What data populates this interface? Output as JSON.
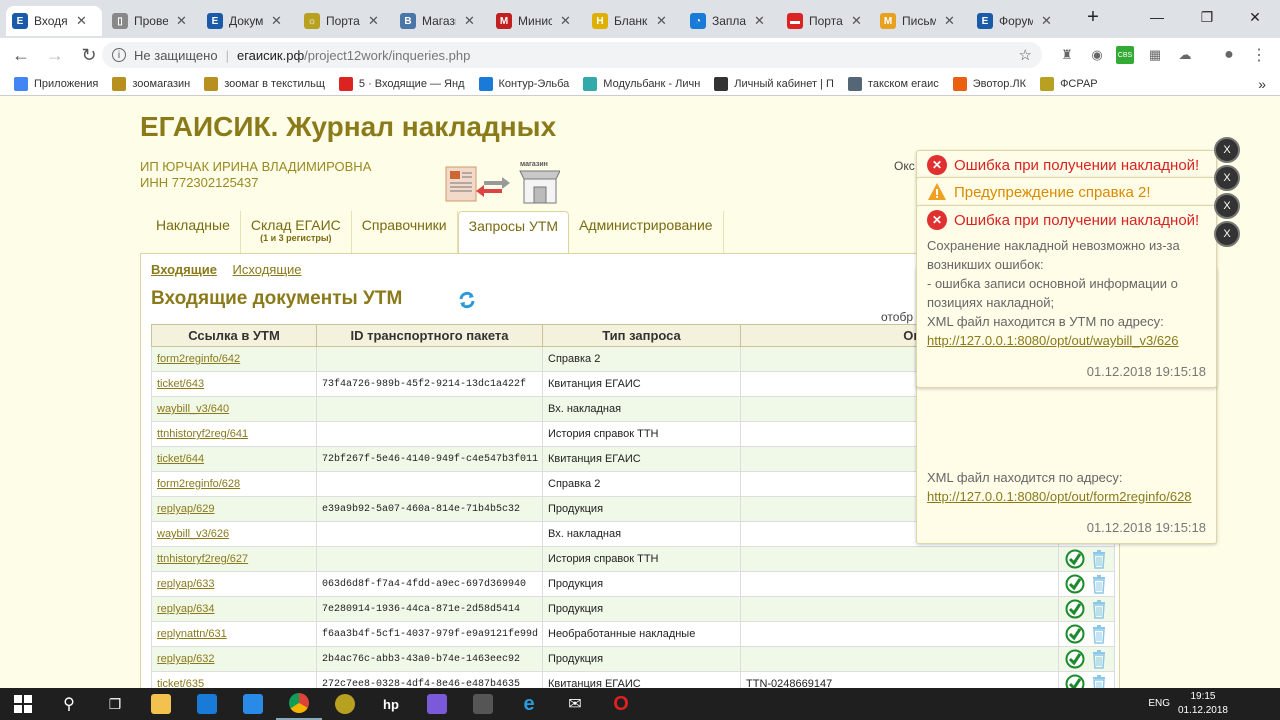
{
  "browser": {
    "tabs": [
      {
        "label": "Входящ",
        "icon": "E",
        "color": "#1a5aa8",
        "active": true
      },
      {
        "label": "Прове",
        "icon": "▯",
        "color": "#888"
      },
      {
        "label": "Докум",
        "icon": "E",
        "color": "#1a5aa8"
      },
      {
        "label": "Порта",
        "icon": "☼",
        "color": "#b8a020"
      },
      {
        "label": "Магази",
        "icon": "B",
        "color": "#4a76a8"
      },
      {
        "label": "Минис",
        "icon": "M",
        "color": "#c02020"
      },
      {
        "label": "Бланк",
        "icon": "H",
        "color": "#e0b000"
      },
      {
        "label": "Запла",
        "icon": "◔",
        "color": "#1a7ad8"
      },
      {
        "label": "Порта",
        "icon": "▬",
        "color": "#d22"
      },
      {
        "label": "Письм",
        "icon": "M",
        "color": "#e8a020"
      },
      {
        "label": "Форум",
        "icon": "E",
        "color": "#1a5aa8"
      }
    ],
    "new_tab": "+",
    "url_insecure": "Не защищено",
    "url_host": "егаисик.рф",
    "url_path": "/project12work/inqueries.php",
    "bookmarks": [
      {
        "label": "Приложения",
        "color": "#4285f4"
      },
      {
        "label": "зоомагазин",
        "color": "#b89020"
      },
      {
        "label": "зоомаг в текстильщ",
        "color": "#b89020"
      },
      {
        "label": "5 · Входящие — Янд",
        "color": "#d22"
      },
      {
        "label": "Контур-Эльба",
        "color": "#1a7ad8"
      },
      {
        "label": "Модульбанк - Личн",
        "color": "#3aa"
      },
      {
        "label": "Личный кабинет | П",
        "color": "#333"
      },
      {
        "label": "такском егаис",
        "color": "#567"
      },
      {
        "label": "Эвотор.ЛК",
        "color": "#e86010"
      },
      {
        "label": "ФСРАР",
        "color": "#b8a020"
      }
    ],
    "bookmarks_more": "»"
  },
  "app": {
    "title": "ЕГАИСИК. Журнал накладных",
    "org_name": "ИП ЮРЧАК ИРИНА ВЛАДИМИРОВНА",
    "inn": "ИНН 772302125437",
    "logo_text_top": "магазин",
    "okso": "Окс",
    "nav": [
      {
        "label": "Накладные"
      },
      {
        "label": "Склад ЕГАИС",
        "sub": "(1 и 3 регистры)"
      },
      {
        "label": "Справочники"
      },
      {
        "label": "Запросы УТМ",
        "active": true
      },
      {
        "label": "Администрирование"
      }
    ],
    "subtabs": {
      "incoming": "Входящие",
      "outgoing": "Исходящие"
    },
    "doc_title": "Входящие документы УТМ",
    "shown_label": "отобр",
    "table": {
      "headers": [
        "Ссылка в УТМ",
        "ID транспортного пакета",
        "Тип запроса",
        "Описан"
      ],
      "rows": [
        {
          "link": "form2reginfo/642",
          "id": "",
          "type": "Справка 2",
          "desc": "",
          "status": ""
        },
        {
          "link": "ticket/643",
          "id": "73f4a726-989b-45f2-9214-13dc1a422f",
          "type": "Квитанция ЕГАИС",
          "desc": "",
          "status": ""
        },
        {
          "link": "waybill_v3/640",
          "id": "",
          "type": "Вх. накладная",
          "desc": "",
          "status": ""
        },
        {
          "link": "ttnhistoryf2reg/641",
          "id": "",
          "type": "История справок ТТН",
          "desc": "",
          "status": ""
        },
        {
          "link": "ticket/644",
          "id": "72bf267f-5e46-4140-949f-c4e547b3f011",
          "type": "Квитанция ЕГАИС",
          "desc": "",
          "status": ""
        },
        {
          "link": "form2reginfo/628",
          "id": "",
          "type": "Справка 2",
          "desc": "",
          "status": "none"
        },
        {
          "link": "replyap/629",
          "id": "e39a9b92-5a07-460a-814e-71b4b5c32",
          "type": "Продукция",
          "desc": "",
          "status": "ok"
        },
        {
          "link": "waybill_v3/626",
          "id": "",
          "type": "Вх. накладная",
          "desc": "",
          "status": "warn"
        },
        {
          "link": "ttnhistoryf2reg/627",
          "id": "",
          "type": "История справок ТТН",
          "desc": "",
          "status": "ok"
        },
        {
          "link": "replyap/633",
          "id": "063d6d8f-f7a4-4fdd-a9ec-697d369940",
          "type": "Продукция",
          "desc": "",
          "status": "ok"
        },
        {
          "link": "replyap/634",
          "id": "7e280914-1936-44ca-871e-2d58d5414",
          "type": "Продукция",
          "desc": "",
          "status": "ok"
        },
        {
          "link": "replynattn/631",
          "id": "f6aa3b4f-5cf1-4037-979f-e9a9121fe99d",
          "type": "Необработанные накладные",
          "desc": "",
          "status": "ok"
        },
        {
          "link": "replyap/632",
          "id": "2b4ac76c-abb3-43a0-b74e-1463eec92",
          "type": "Продукция",
          "desc": "",
          "status": "ok"
        },
        {
          "link": "ticket/635",
          "id": "272c7ee8-0328-4df4-8e46-e487b4635",
          "type": "Квитанция ЕГАИС",
          "desc": "TTN-0248669147",
          "status": "ok"
        }
      ]
    }
  },
  "notifications": [
    {
      "kind": "error",
      "title": "Ошибка при получении накладной!"
    },
    {
      "kind": "warning",
      "title": "Предупреждение справка 2!"
    },
    {
      "kind": "error",
      "title": "Ошибка при получении накладной!",
      "lines": [
        "Сохранение накладной невозможно из-за возникших ошибок:",
        "- ошибка записи основной информации о позициях накладной;",
        "XML файл находится в УТМ по адресу:"
      ],
      "link": "http://127.0.0.1:8080/opt/out/waybill_v3/626",
      "time": "01.12.2018 19:15:18"
    },
    {
      "kind": "warning",
      "lines": [
        "XML файл находится по адресу:"
      ],
      "link": "http://127.0.0.1:8080/opt/out/form2reginfo/628",
      "time": "01.12.2018 19:15:18"
    }
  ],
  "close_label": "X",
  "taskbar": {
    "lang": "ENG",
    "time": "19:15",
    "date": "01.12.2018"
  }
}
